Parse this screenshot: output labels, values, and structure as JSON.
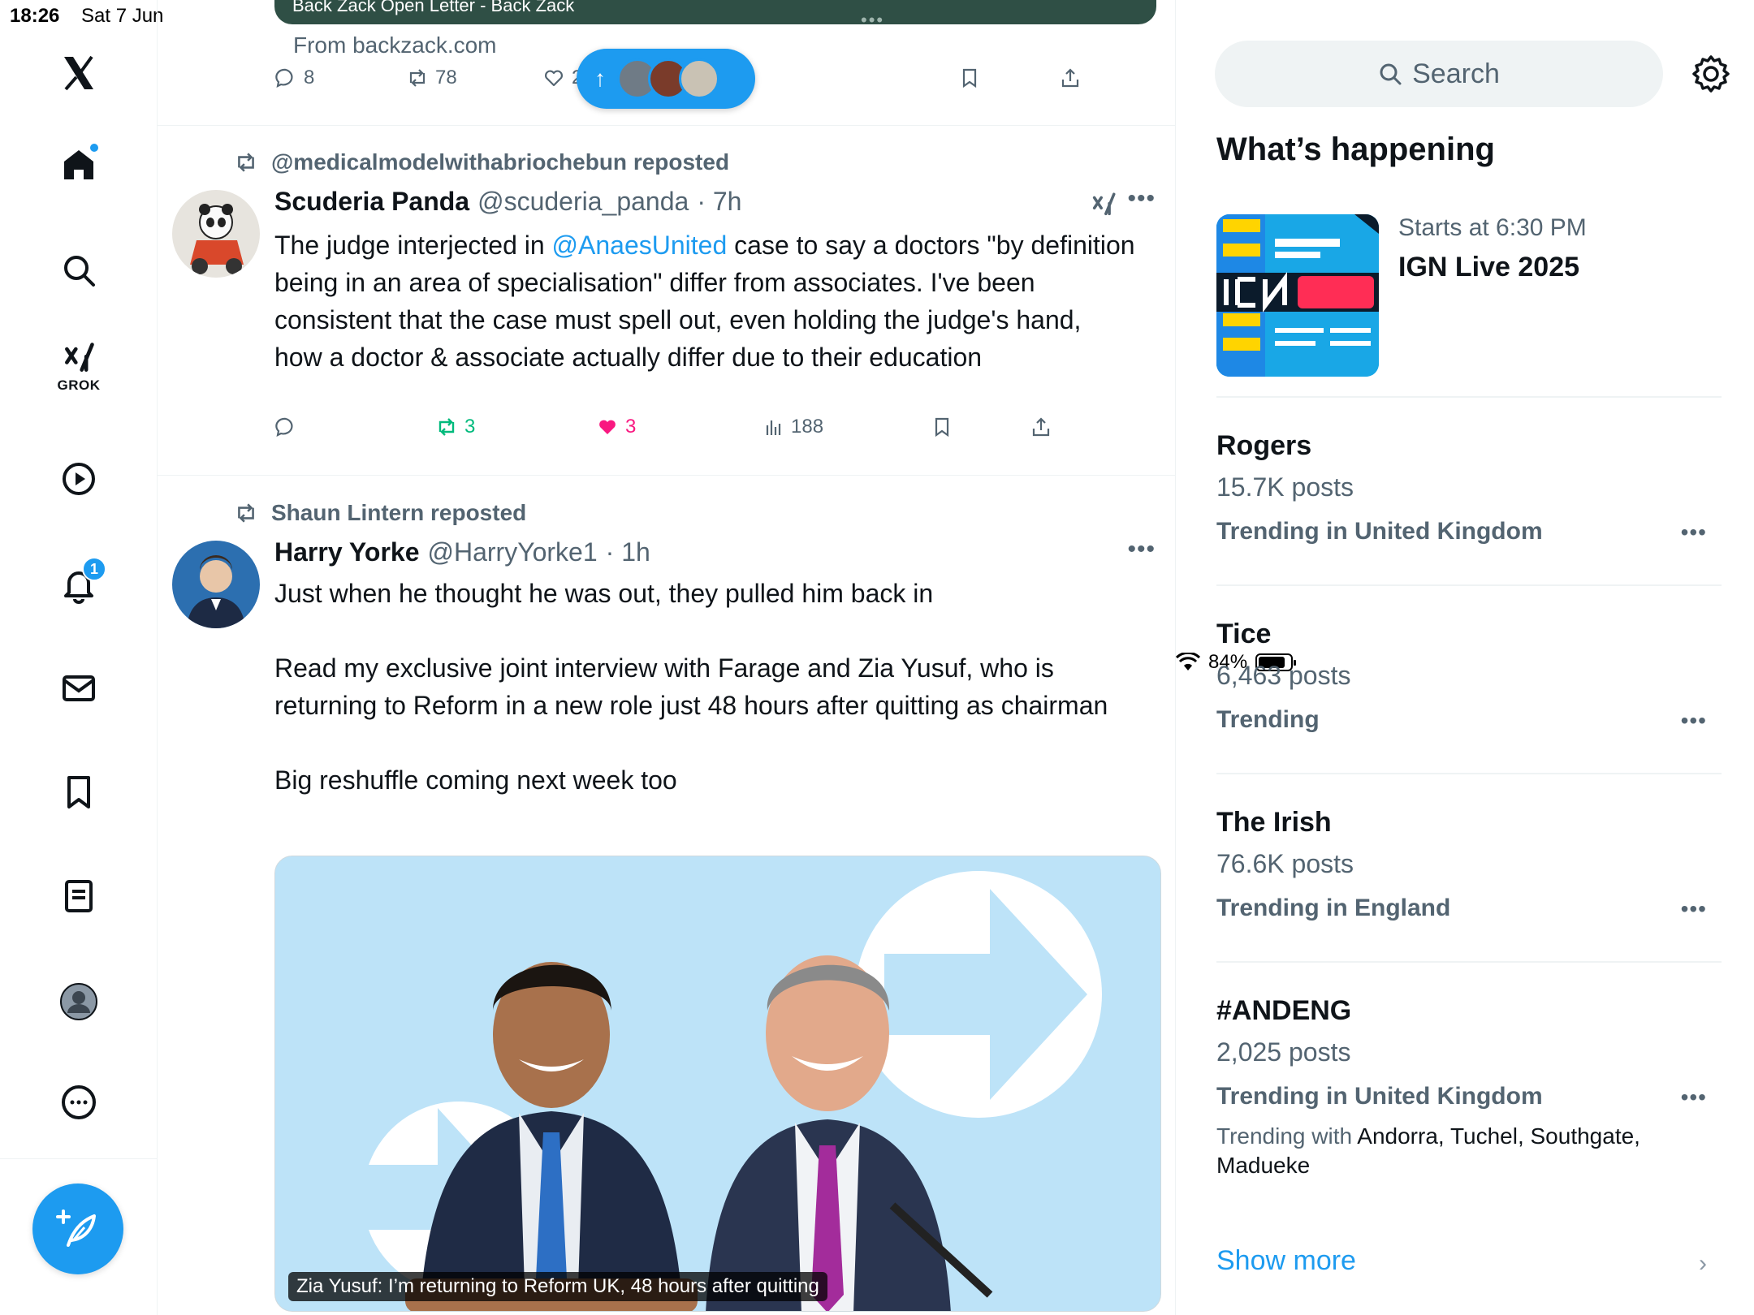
{
  "status_bar": {
    "time": "18:26",
    "date": "Sat 7 Jun",
    "battery": "84%",
    "battery_level": 0.84
  },
  "nav": {
    "grok_label": "GROK",
    "notifications_badge": "1"
  },
  "timeline": {
    "top_card": {
      "title": "Back Zack Open Letter - Back Zack",
      "source": "From backzack.com",
      "replies": "8",
      "reposts": "78",
      "likes": "2"
    },
    "new_posts_arrow": "↑",
    "tweet1": {
      "repost_line": "@medicalmodelwithabriochebun reposted",
      "name": "Scuderia Panda",
      "handle": "@scuderia_panda",
      "time": "· 7h",
      "text_before": "The judge interjected in ",
      "mention": "@AnaesUnited",
      "text_after": " case to say a doctors \"by definition being in an area of specialisation\" differ from associates. I've been consistent that the case must spell out, even holding the judge's hand, how a doctor & associate actually differ due to their education",
      "reposts": "3",
      "likes": "3",
      "views": "188"
    },
    "tweet2": {
      "repost_line": "Shaun Lintern reposted",
      "name": "Harry Yorke",
      "handle": "@HarryYorke1",
      "time": "· 1h",
      "text": "Just when he thought he was out, they pulled him back in\n\nRead my exclusive joint interview with Farage and Zia Yusuf, who is returning to Reform in a new role just 48 hours after quitting as chairman\n\nBig reshuffle coming next week too",
      "media_caption": "Zia Yusuf: I’m returning to Reform UK, 48 hours after quitting"
    }
  },
  "sidebar": {
    "search_placeholder": "Search",
    "section_title": "What’s happening",
    "event": {
      "subtitle": "Starts at 6:30 PM",
      "title": "IGN Live 2025"
    },
    "trends": [
      {
        "title": "Rogers",
        "count": "15.7K posts",
        "context": "Trending in United Kingdom"
      },
      {
        "title": "Tice",
        "count": "6,463 posts",
        "context": "Trending"
      },
      {
        "title": "The Irish",
        "count": "76.6K posts",
        "context": "Trending in England"
      },
      {
        "title": "#ANDENG",
        "count": "2,025 posts",
        "context": "Trending in United Kingdom",
        "with_label": "Trending with",
        "with_items": "Andorra, Tuchel, Southgate, Madueke"
      }
    ],
    "show_more": "Show more"
  },
  "colors": {
    "accent": "#1d9bf0",
    "like": "#f91880",
    "repost": "#00ba7c",
    "muted": "#536471"
  }
}
